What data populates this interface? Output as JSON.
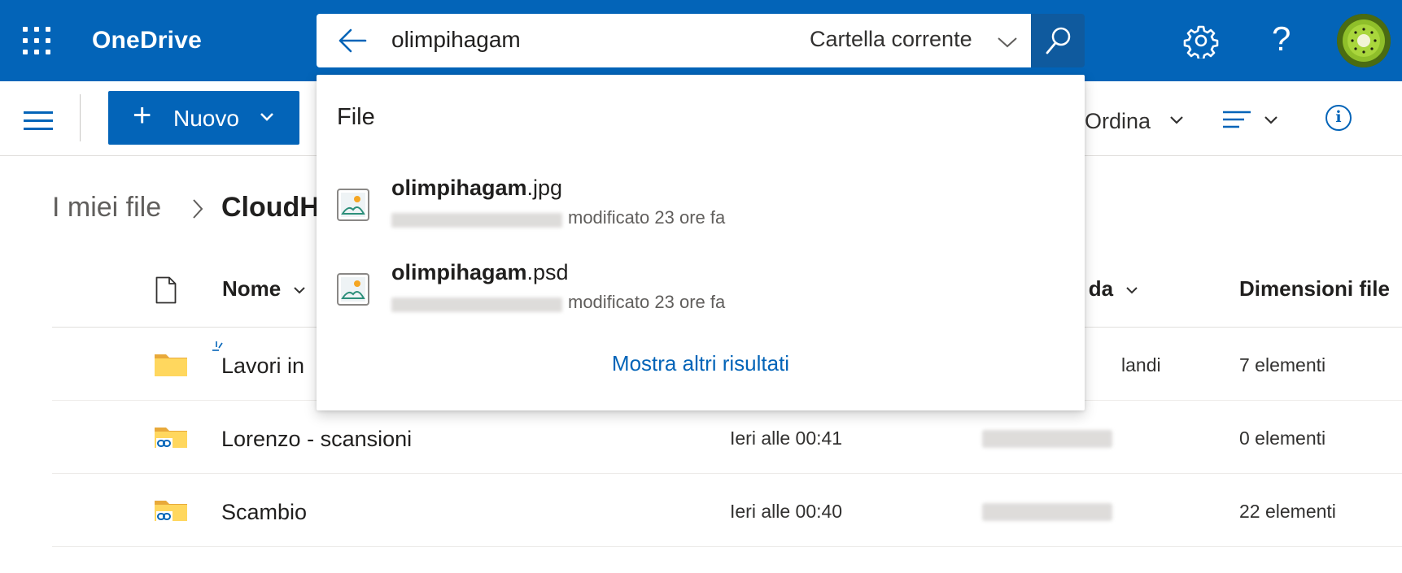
{
  "header": {
    "app_name": "OneDrive",
    "search": {
      "query": "olimpihagam",
      "scope": "Cartella corrente"
    },
    "help_label": "?"
  },
  "command_bar": {
    "new_label": "Nuovo",
    "sort_label": "Ordina"
  },
  "breadcrumb": {
    "root": "I miei file",
    "current": "CloudH"
  },
  "file_list": {
    "columns": {
      "name": "Nome",
      "modified_by": "to da",
      "size": "Dimensioni file"
    },
    "rows": [
      {
        "name": "Lavori in",
        "modified": "",
        "modified_by": "landi",
        "size": "7 elementi"
      },
      {
        "name": "Lorenzo - scansioni",
        "modified": "Ieri alle 00:41",
        "modified_by": "",
        "size": "0 elementi"
      },
      {
        "name": "Scambio",
        "modified": "Ieri alle 00:40",
        "modified_by": "",
        "size": "22 elementi"
      }
    ]
  },
  "search_dropdown": {
    "section_title": "File",
    "results": [
      {
        "name_match": "olimpihagam",
        "extension": ".jpg",
        "meta": "modificato 23 ore fa"
      },
      {
        "name_match": "olimpihagam",
        "extension": ".psd",
        "meta": "modificato 23 ore fa"
      }
    ],
    "show_more_label": "Mostra altri risultati"
  },
  "colors": {
    "header_bg": "#0364b8",
    "accent": "#0364b8",
    "search_button_bg": "#0f5a9e",
    "folder": "#ffd75e"
  }
}
